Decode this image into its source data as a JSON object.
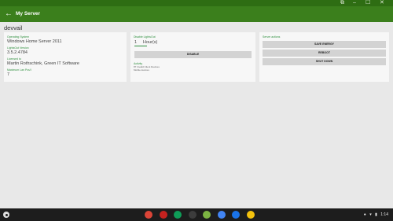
{
  "statusbar": {
    "restore": "⧉",
    "minimize": "–",
    "maximize": "☐",
    "close": "✕"
  },
  "appbar": {
    "back": "←",
    "title": "My Server"
  },
  "hostname": "devvail",
  "server_card": {
    "os_label": "Operating System",
    "os_value": "Windows Home Server 2011",
    "version_label": "LightsOut Version",
    "version_value": "3.5.2.4784",
    "licensed_label": "Licensed to",
    "licensed_value": "Martin Rothschink, Green IT Software",
    "pcs_label": "Maximum Lan Pcs/l",
    "pcs_value": "7"
  },
  "sleep_card": {
    "label": "Disable LightsOut",
    "hours_value": "1",
    "hours_unit": "Hour(s)",
    "disable_button": "DISABLE",
    "activity_label": "Activity",
    "activity_lines": [
      "87 Invalid Client Devices",
      "Mobile devices"
    ]
  },
  "actions_card": {
    "label": "Server actions",
    "buttons": [
      "SAVE ENERGY",
      "REBOOT",
      "SHUT DOWN"
    ]
  },
  "shelf": {
    "apps": [
      {
        "name": "chrome",
        "color": "#db4437"
      },
      {
        "name": "gmail",
        "color": "#c5221f"
      },
      {
        "name": "hangouts",
        "color": "#0f9d58"
      },
      {
        "name": "terminal",
        "color": "#3c3c3c"
      },
      {
        "name": "android-app",
        "color": "#7cb342"
      },
      {
        "name": "settings",
        "color": "#4285f4"
      },
      {
        "name": "files",
        "color": "#1a73e8"
      },
      {
        "name": "keep",
        "color": "#f4c20d"
      }
    ],
    "clock": "1:14"
  }
}
